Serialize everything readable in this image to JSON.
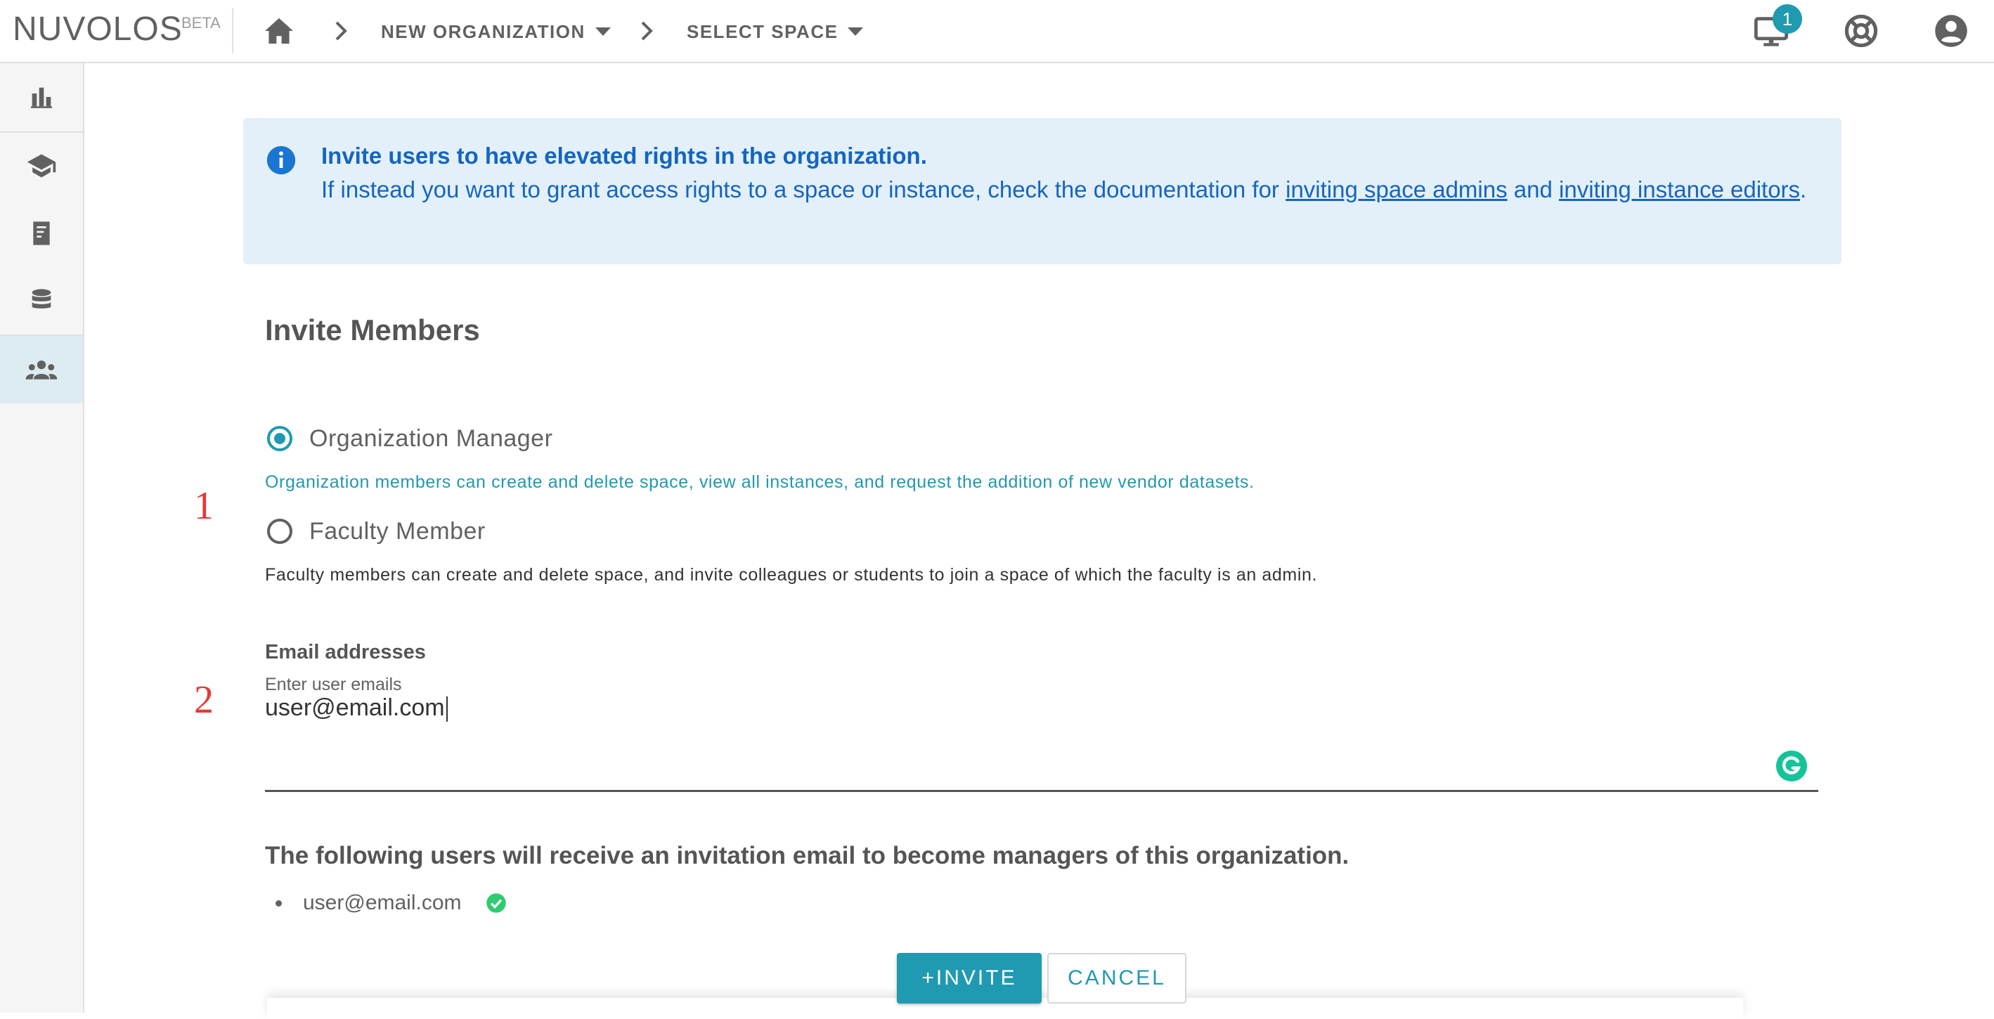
{
  "topbar": {
    "brand": "NUVOLOS",
    "brand_tag": "BETA",
    "breadcrumbs": [
      {
        "label": "NEW ORGANIZATION"
      },
      {
        "label": "SELECT SPACE"
      }
    ],
    "notification_count": "1"
  },
  "sidebar": {
    "items": [
      {
        "icon": "bar-chart-icon"
      },
      {
        "icon": "graduation-cap-icon"
      },
      {
        "icon": "notebook-icon"
      },
      {
        "icon": "database-icon"
      },
      {
        "icon": "users-icon",
        "active": true
      }
    ]
  },
  "info": {
    "title": "Invite users to have elevated rights in the organization.",
    "body_prefix": "If instead you want to grant access rights to a space or instance, check the documentation for ",
    "link1": "inviting space admins",
    "middle": " and ",
    "link2": "inviting instance editors",
    "suffix": "."
  },
  "form": {
    "heading": "Invite Members",
    "roles": [
      {
        "label": "Organization Manager",
        "selected": true,
        "hint": "Organization members can create and delete space, view all instances, and request the addition of new vendor datasets."
      },
      {
        "label": "Faculty Member",
        "selected": false,
        "hint": "Faculty members can create and delete space, and invite colleagues or students to join a space of which the faculty is an admin."
      }
    ],
    "email_label": "Email addresses",
    "email_placeholder": "Enter user emails",
    "email_value": "user@email.com",
    "recipients_heading": "The following users will receive an invitation email to become managers of this organization.",
    "recipients": [
      "user@email.com"
    ],
    "invite_label": "+INVITE",
    "cancel_label": "CANCEL"
  },
  "annotations": {
    "step1": "1",
    "step2": "2"
  },
  "colors": {
    "accent": "#1f9ab0",
    "info_bg": "#e3f0fa",
    "info_text": "#1565c0",
    "annotation": "#e53935"
  }
}
